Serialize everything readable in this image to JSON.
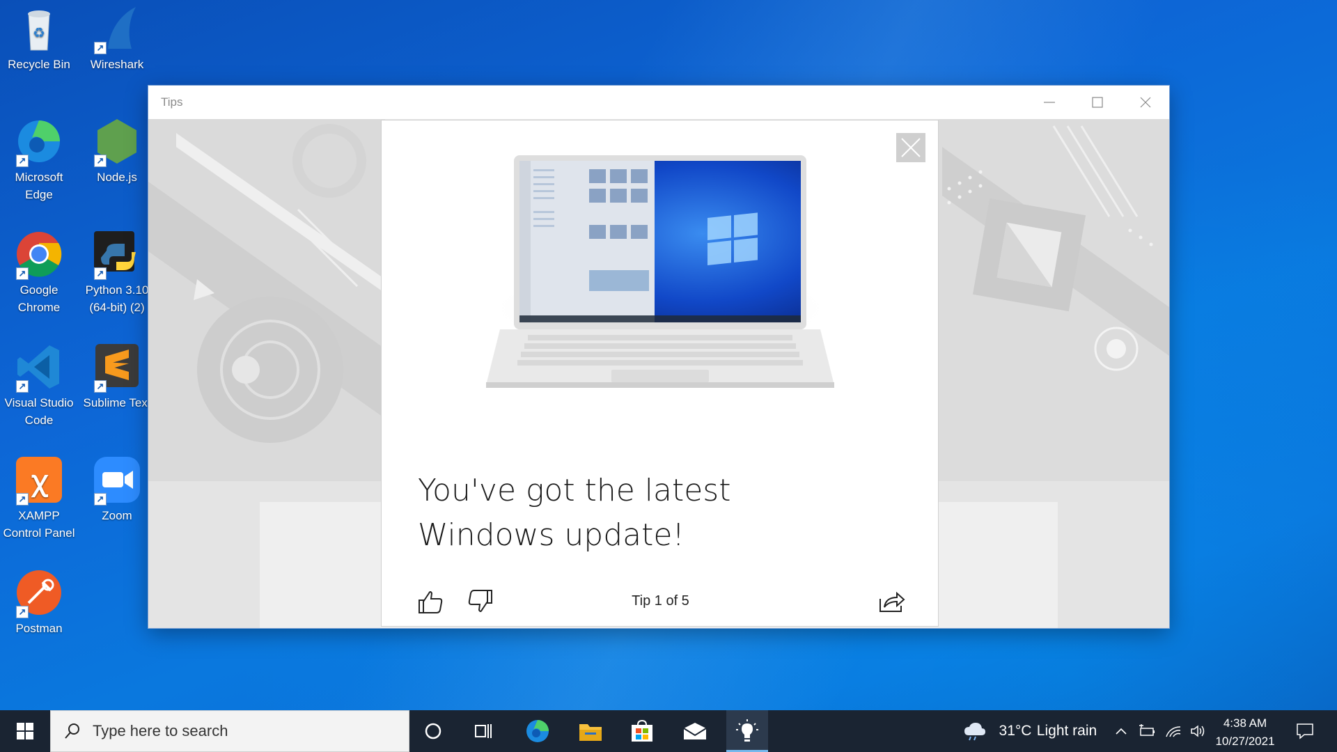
{
  "desktop": {
    "icons": [
      {
        "label": "Recycle Bin",
        "icon": "recycle-bin-icon"
      },
      {
        "label": "Wireshark",
        "icon": "wireshark-icon"
      },
      {
        "label": "Microsoft\nEdge",
        "icon": "edge-icon"
      },
      {
        "label": "Node.js",
        "icon": "nodejs-icon"
      },
      {
        "label": "Google\nChrome",
        "icon": "chrome-icon"
      },
      {
        "label": "Python 3.10\n(64-bit) (2)",
        "icon": "python-icon"
      },
      {
        "label": "Visual Studio\nCode",
        "icon": "vscode-icon"
      },
      {
        "label": "Sublime Text",
        "icon": "sublime-icon"
      },
      {
        "label": "XAMPP\nControl Panel",
        "icon": "xampp-icon"
      },
      {
        "label": "Zoom",
        "icon": "zoom-icon"
      },
      {
        "label": "Postman",
        "icon": "postman-icon"
      }
    ]
  },
  "window": {
    "title": "Tips",
    "controls": [
      "minimize",
      "maximize",
      "close"
    ]
  },
  "card": {
    "headline_line1": "You've got the latest",
    "headline_line2": "Windows update!",
    "tip_counter": "Tip 1 of 5",
    "buttons": [
      "thumbs-up",
      "thumbs-down",
      "share"
    ]
  },
  "taskbar": {
    "search_placeholder": "Type here to search",
    "weather_temp": "31°C",
    "weather_text": "Light rain",
    "time": "4:38 AM",
    "date": "10/27/2021",
    "apps": [
      "cortana",
      "task-view",
      "edge",
      "file-explorer",
      "store",
      "mail",
      "tips"
    ]
  }
}
